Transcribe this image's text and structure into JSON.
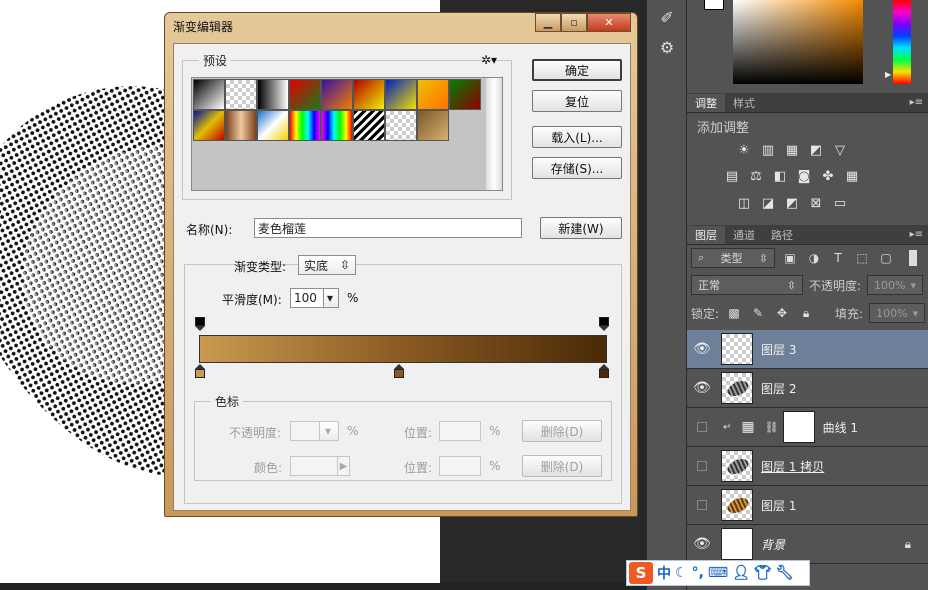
{
  "dialog": {
    "title": "渐变编辑器",
    "presets_label": "预设",
    "ok": "确定",
    "reset": "复位",
    "load": "载入(L)...",
    "save": "存储(S)...",
    "name_label": "名称(N):",
    "name_value": "麦色榴莲",
    "new": "新建(W)",
    "gradient_type_label": "渐变类型:",
    "gradient_type_value": "实底",
    "smooth_label": "平滑度(M):",
    "smooth_value": "100",
    "smooth_unit": "%",
    "stops_group_label": "色标",
    "opacity_label": "不透明度:",
    "opacity_unit": "%",
    "location_label": "位置:",
    "location_unit": "%",
    "delete": "删除(D)",
    "color_label": "颜色:",
    "gradient_colors": [
      "#c99a50",
      "#8a5a22",
      "#4a2a08"
    ],
    "preset_gradients": [
      "linear-gradient(135deg,#000,#fff)",
      "checker-black",
      "linear-gradient(90deg,#000,#fff)",
      "linear-gradient(135deg,#e00000,#1a7a1a)",
      "linear-gradient(135deg,#3a0fa0,#f08000)",
      "linear-gradient(135deg,#b00000,#f0f000)",
      "linear-gradient(135deg,#0020c0,#f0e000)",
      "linear-gradient(135deg,#f0c000,#ff7000)",
      "linear-gradient(135deg,#008000,#900000)",
      "linear-gradient(135deg,#0010a0,#e0c000,#c00000)",
      "linear-gradient(90deg,#7a4020,#f0c8a0,#7a4020)",
      "linear-gradient(135deg,#1a70d0,#fff,#f0d000)",
      "linear-gradient(90deg,#f00,#ff0,#0f0,#0ff,#00f,#f0f)",
      "linear-gradient(90deg,#f0f,#00f,#0ff,#0f0,#ff0,#f00)",
      "stripes",
      "checker",
      "linear-gradient(135deg,#7a5a2a,#d8b070)"
    ]
  },
  "right_panels": {
    "adjust_tab": "调整",
    "style_tab": "样式",
    "add_adjustment": "添加调整",
    "layers_tab": "图层",
    "channels_tab": "通道",
    "paths_tab": "路径",
    "kind_filter": "类型",
    "blend_mode": "正常",
    "opacity_label": "不透明度:",
    "opacity_value": "100%",
    "lock_label": "锁定:",
    "fill_label": "填充:",
    "fill_value": "100%"
  },
  "layers": [
    {
      "name": "图层 3",
      "visible": true,
      "thumb": "checker"
    },
    {
      "name": "图层 2",
      "visible": true,
      "thumb": "gray"
    },
    {
      "name": "曲线 1",
      "visible": false,
      "thumb": "adjust"
    },
    {
      "name": "图层 1 拷贝",
      "visible": false,
      "thumb": "gray"
    },
    {
      "name": "图层 1",
      "visible": false,
      "thumb": "gold"
    },
    {
      "name": "背景",
      "visible": true,
      "thumb": "white",
      "locked": true
    }
  ],
  "ime": {
    "logo": "S",
    "mode": "中"
  }
}
